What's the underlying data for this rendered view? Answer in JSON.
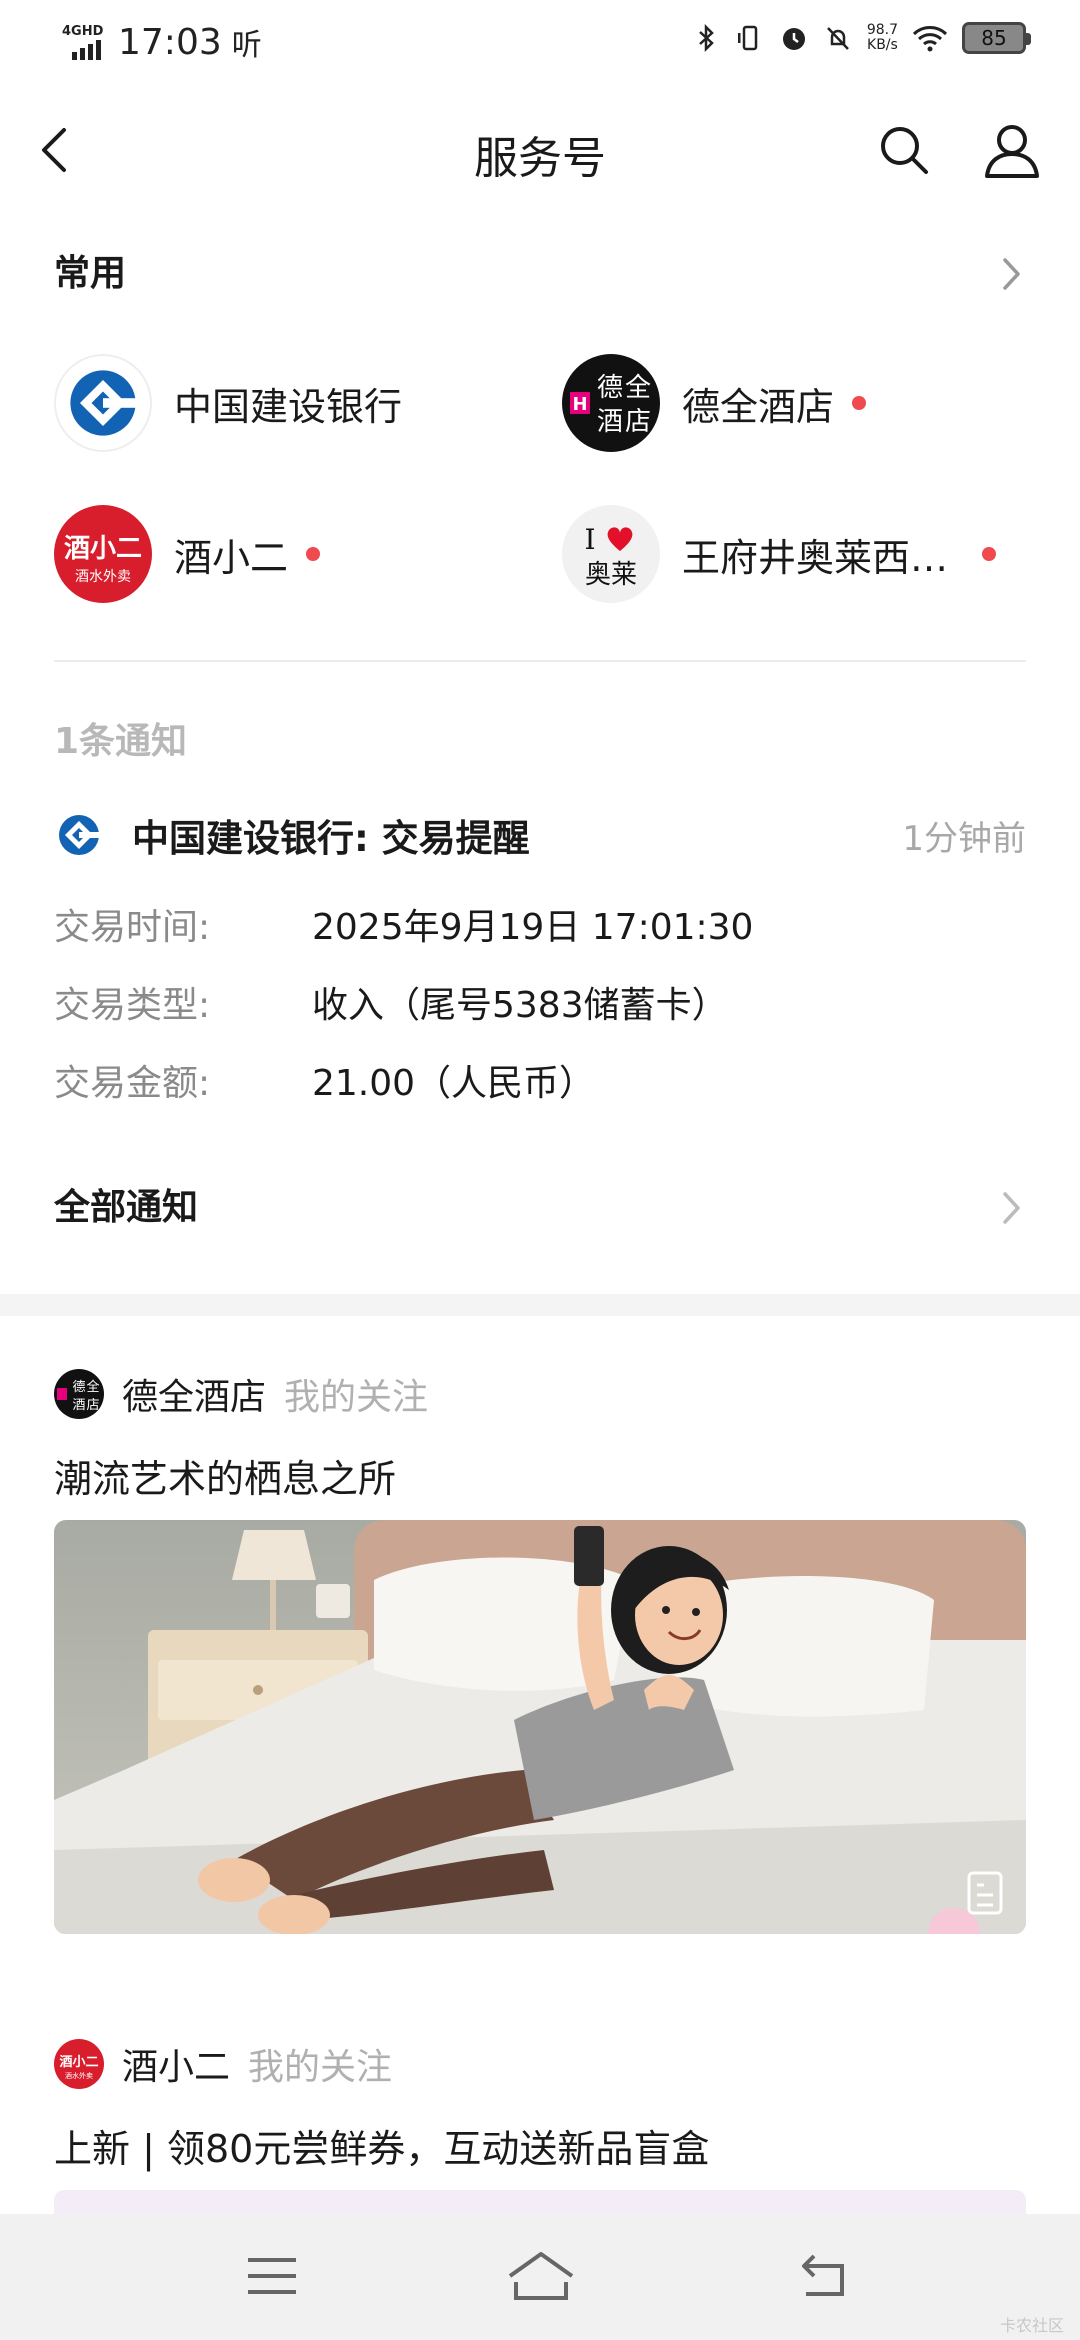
{
  "status_bar": {
    "network": "4GHD",
    "time": "17:03",
    "hd_label": "听",
    "net_speed_value": "98.7",
    "net_speed_unit": "KB/s",
    "battery": "85"
  },
  "header": {
    "title": "服务号"
  },
  "frequent": {
    "label": "常用",
    "accounts": [
      {
        "name": "中国建设银行",
        "unread": false
      },
      {
        "name": "德全酒店",
        "unread": true
      },
      {
        "name": "酒小二",
        "unread": true
      },
      {
        "name": "王府井奥莱西…",
        "unread": true
      }
    ],
    "avatar_text": {
      "dequan": [
        "德",
        "全",
        "酒",
        "店",
        "H"
      ],
      "jiuxiaoer_top": "酒小二",
      "jiuxiaoer_bottom": "酒水外卖",
      "aolai_top": "I",
      "aolai_bottom": "奥莱"
    }
  },
  "notifications": {
    "count_label": "1条通知",
    "item": {
      "title": "中国建设银行: 交易提醒",
      "time": "1分钟前",
      "fields": [
        {
          "key": "交易时间:",
          "value": "2025年9月19日 17:01:30"
        },
        {
          "key": "交易类型:",
          "value": "收入（尾号5383储蓄卡）"
        },
        {
          "key": "交易金额:",
          "value": "21.00（人民币）"
        }
      ]
    },
    "all_label": "全部通知"
  },
  "feed": [
    {
      "source": "德全酒店",
      "follow_label": "我的关注",
      "title": "潮流艺术的栖息之所"
    },
    {
      "source": "酒小二",
      "follow_label": "我的关注",
      "title": "上新 | 领80元尝鲜券，互动送新品盲盒"
    }
  ],
  "watermark": "卡农社区",
  "colors": {
    "unread_dot": "#f0494e",
    "ccb_blue": "#1363b4",
    "jiuxiaoer_red": "#d81e2c",
    "aolai_heart": "#e3102a"
  },
  "icons": [
    "back-arrow-icon",
    "search-icon",
    "user-icon",
    "chevron-right-icon",
    "menu-icon",
    "home-icon",
    "return-icon"
  ]
}
